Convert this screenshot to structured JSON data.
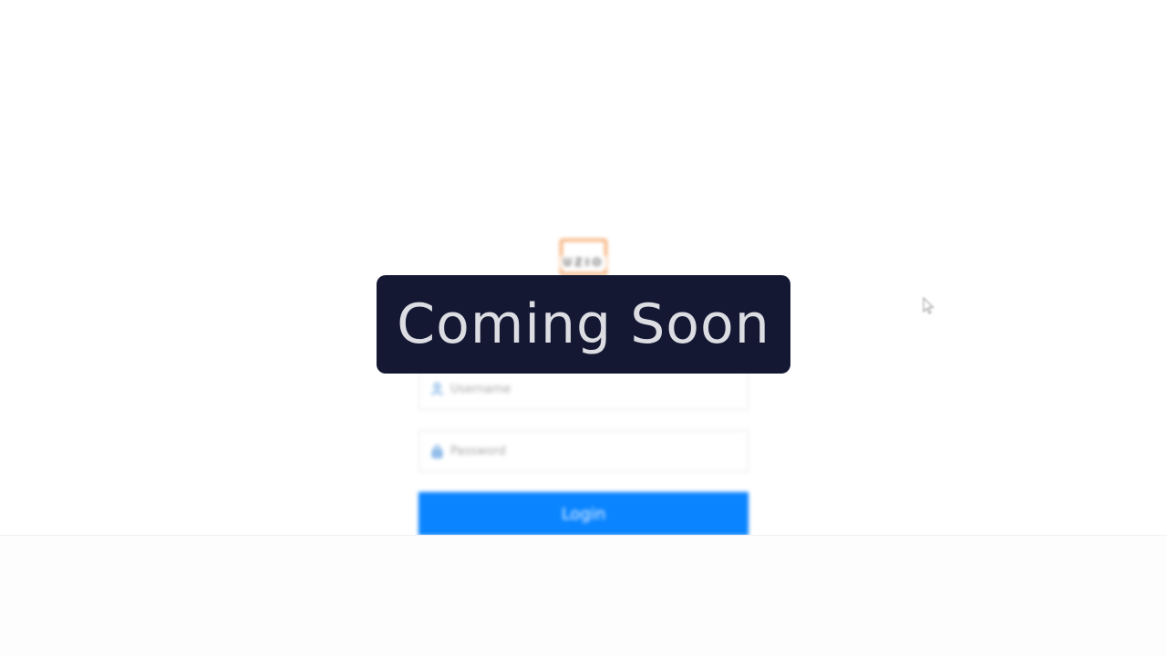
{
  "logo": {
    "text": "UZIO",
    "border_color": "#f3a565"
  },
  "login_form": {
    "username_placeholder": "Username",
    "username_icon": "user-icon",
    "password_placeholder": "Password",
    "password_icon": "lock-icon",
    "login_label": "Login",
    "login_color": "#0a84ff"
  },
  "overlay": {
    "text": "Coming Soon",
    "background": "#141833"
  }
}
